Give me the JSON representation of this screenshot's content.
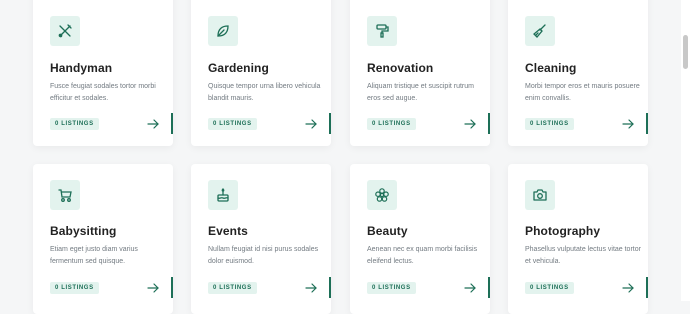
{
  "colors": {
    "accent": "#1d6f57",
    "icon_bg": "#e3f3ee"
  },
  "categories": [
    {
      "title": "Handyman",
      "desc": "Fusce feugiat sodales tortor morbi efficitur et sodales.",
      "listings": "0 LISTINGS",
      "icon": "tools-icon"
    },
    {
      "title": "Gardening",
      "desc": "Quisque tempor urna libero vehicula blandit mauris.",
      "listings": "0 LISTINGS",
      "icon": "leaf-icon"
    },
    {
      "title": "Renovation",
      "desc": "Aliquam tristique et suscipit rutrum eros sed augue.",
      "listings": "0 LISTINGS",
      "icon": "paint-roller-icon"
    },
    {
      "title": "Cleaning",
      "desc": "Morbi tempor eros et mauris posuere enim convallis.",
      "listings": "0 LISTINGS",
      "icon": "broom-icon"
    },
    {
      "title": "Babysitting",
      "desc": "Etiam eget justo diam varius fermentum sed quisque.",
      "listings": "0 LISTINGS",
      "icon": "stroller-icon"
    },
    {
      "title": "Events",
      "desc": "Nullam feugiat id nisi purus sodales dolor euismod.",
      "listings": "0 LISTINGS",
      "icon": "cake-icon"
    },
    {
      "title": "Beauty",
      "desc": "Aenean nec ex quam morbi facilisis eleifend lectus.",
      "listings": "0 LISTINGS",
      "icon": "flower-icon"
    },
    {
      "title": "Photography",
      "desc": "Phasellus vulputate lectus vitae tortor et vehicula.",
      "listings": "0 LISTINGS",
      "icon": "camera-icon"
    }
  ]
}
